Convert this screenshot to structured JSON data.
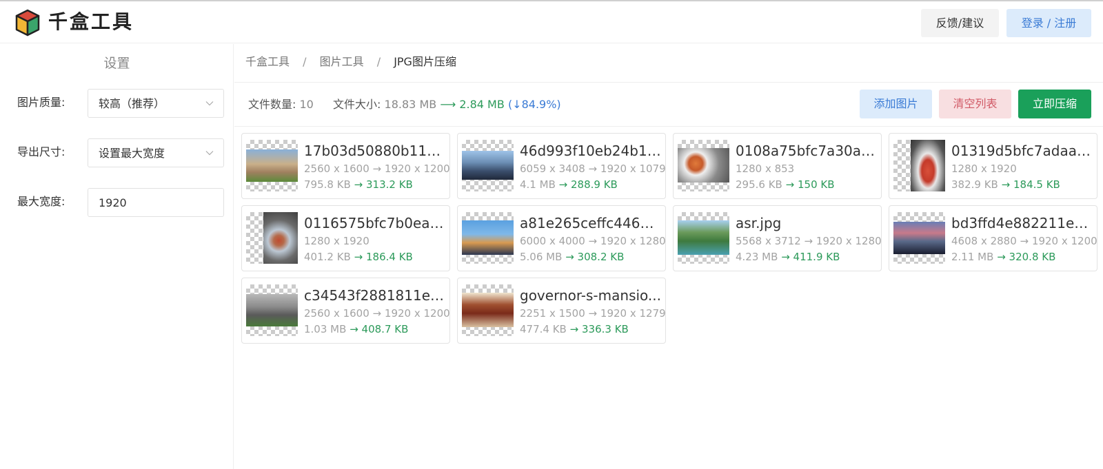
{
  "app": {
    "title": "千盒工具"
  },
  "header": {
    "feedback_label": "反馈/建议",
    "login_label": "登录 / 注册"
  },
  "sidebar": {
    "title": "设置",
    "quality_label": "图片质量:",
    "quality_value": "较高（推荐）",
    "size_label": "导出尺寸:",
    "size_value": "设置最大宽度",
    "max_width_label": "最大宽度:",
    "max_width_value": "1920"
  },
  "breadcrumb": {
    "items": [
      "千盒工具",
      "图片工具",
      "JPG图片压缩"
    ],
    "separator": "/"
  },
  "toolbar": {
    "count_label": "文件数量:",
    "count_value": "10",
    "size_label": "文件大小:",
    "size_before": "18.83 MB",
    "arrow": "⟶",
    "size_after": "2.84 MB",
    "ratio": "(↓84.9%)",
    "add_label": "添加图片",
    "clear_label": "清空列表",
    "compress_label": "立即压缩"
  },
  "files": [
    {
      "name": "17b03d50880b11e...",
      "dim_before": "2560 x 1600",
      "dim_after": "1920 x 1200",
      "size_before": "795.8 KB",
      "size_after": "313.2 KB"
    },
    {
      "name": "46d993f10eb24b19...",
      "dim_before": "6059 x 3408",
      "dim_after": "1920 x 1079",
      "size_before": "4.1 MB",
      "size_after": "288.9 KB"
    },
    {
      "name": "0108a75bfc7a30a8...",
      "dim_before": "1280 x 853",
      "dim_after": "",
      "size_before": "295.6 KB",
      "size_after": "150 KB"
    },
    {
      "name": "01319d5bfc7adaa8...",
      "dim_before": "1280 x 1920",
      "dim_after": "",
      "size_before": "382.9 KB",
      "size_after": "184.5 KB"
    },
    {
      "name": "0116575bfc7b0ea8...",
      "dim_before": "1280 x 1920",
      "dim_after": "",
      "size_before": "401.2 KB",
      "size_after": "186.4 KB"
    },
    {
      "name": "a81e265ceffc44688...",
      "dim_before": "6000 x 4000",
      "dim_after": "1920 x 1280",
      "size_before": "5.06 MB",
      "size_after": "308.2 KB"
    },
    {
      "name": "asr.jpg",
      "dim_before": "5568 x 3712",
      "dim_after": "1920 x 1280",
      "size_before": "4.23 MB",
      "size_after": "411.9 KB"
    },
    {
      "name": "bd3ffd4e882211eb...",
      "dim_before": "4608 x 2880",
      "dim_after": "1920 x 1200",
      "size_before": "2.11 MB",
      "size_after": "320.8 KB"
    },
    {
      "name": "c34543f2881811eb...",
      "dim_before": "2560 x 1600",
      "dim_after": "1920 x 1200",
      "size_before": "1.03 MB",
      "size_after": "408.7 KB"
    },
    {
      "name": "governor-s-mansio...",
      "dim_before": "2251 x 1500",
      "dim_after": "1920 x 1279",
      "size_before": "477.4 KB",
      "size_after": "336.3 KB"
    }
  ],
  "colors": {
    "accent_green": "#1aa05a",
    "accent_blue": "#3a7bd5",
    "danger": "#d15a66"
  }
}
